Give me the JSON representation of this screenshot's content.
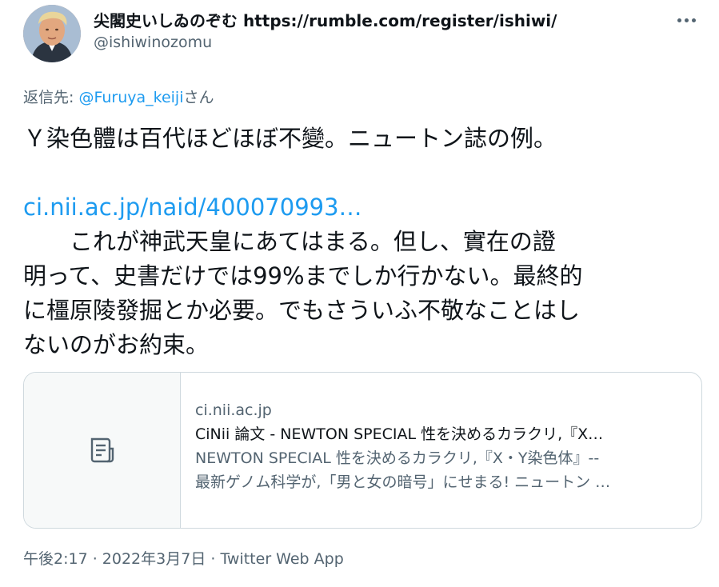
{
  "user": {
    "display_name": "尖閣史いしゐのぞむ https://rumble.com/register/ishiwi/",
    "handle": "@ishiwinozomu"
  },
  "reply": {
    "prefix": "返信先: ",
    "target": "@Furuya_keiji",
    "suffix": "さん"
  },
  "tweet": {
    "line1": "Ｙ染色體は百代ほどほぼ不變。ニュートン誌の例。",
    "url": "ci.nii.ac.jp/naid/400070993…",
    "line3": "　　これが神武天皇にあてはまる。但し、實在の證",
    "line4": "明って、史書だけでは99%までしか行かない。最終的",
    "line5": "に橿原陵發掘とか必要。でもさういふ不敬なことはし",
    "line6": "ないのがお約束。"
  },
  "card": {
    "domain": "ci.nii.ac.jp",
    "title": "CiNii 論文 - NEWTON SPECIAL 性を決めるカラクリ,『X…",
    "desc_line1": "NEWTON SPECIAL 性を決めるカラクリ,『X・Y染色体』--",
    "desc_line2": "最新ゲノム科学が,「男と女の暗号」にせまる! ニュートン …"
  },
  "meta": {
    "time": "午後2:17",
    "sep1": " · ",
    "date": "2022年3月7日",
    "sep2": " · ",
    "app": "Twitter Web App"
  },
  "colors": {
    "link": "#1d9bf0",
    "secondary": "#536471",
    "border": "#cfd9de"
  }
}
